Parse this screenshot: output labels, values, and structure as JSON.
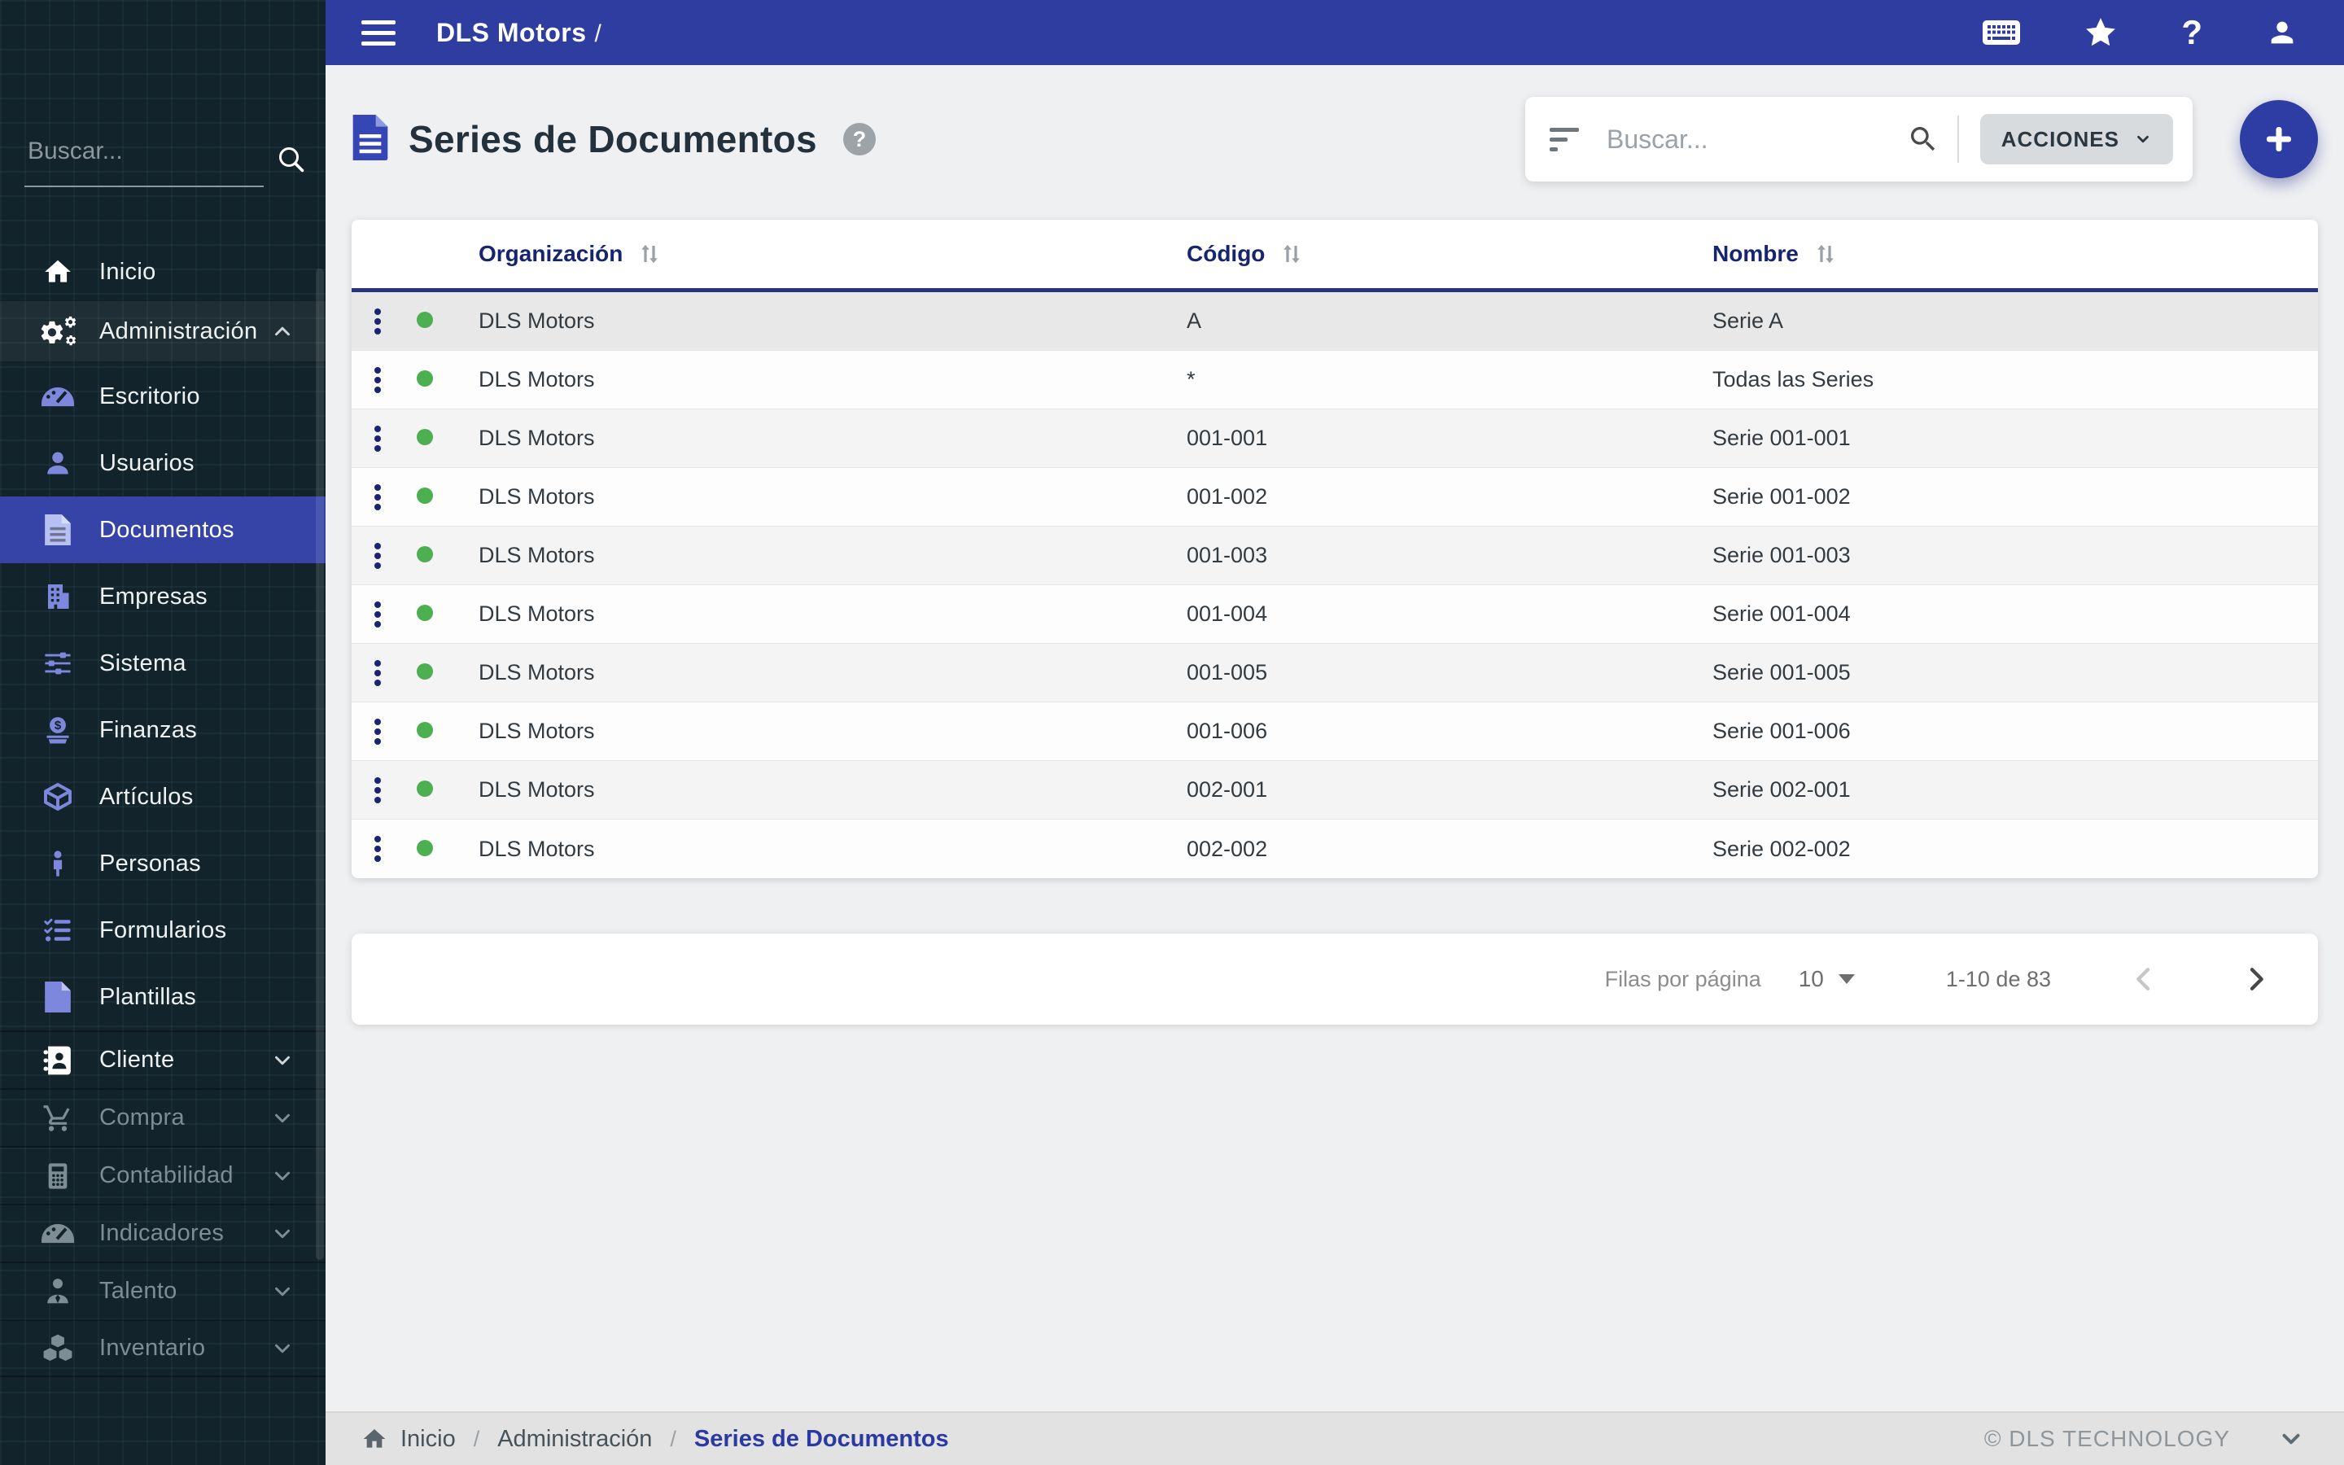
{
  "topbar": {
    "app_title": "DLS Motors",
    "title_separator": "/"
  },
  "icons": {
    "help_glyph": "?"
  },
  "sidebar": {
    "search_placeholder": "Buscar...",
    "items": [
      {
        "label": "Inicio"
      },
      {
        "label": "Administración"
      },
      {
        "label": "Escritorio"
      },
      {
        "label": "Usuarios"
      },
      {
        "label": "Documentos"
      },
      {
        "label": "Empresas"
      },
      {
        "label": "Sistema"
      },
      {
        "label": "Finanzas"
      },
      {
        "label": "Artículos"
      },
      {
        "label": "Personas"
      },
      {
        "label": "Formularios"
      },
      {
        "label": "Plantillas"
      },
      {
        "label": "Cliente"
      },
      {
        "label": "Compra"
      },
      {
        "label": "Contabilidad"
      },
      {
        "label": "Indicadores"
      },
      {
        "label": "Talento"
      },
      {
        "label": "Inventario"
      }
    ]
  },
  "page": {
    "title": "Series de Documentos"
  },
  "toolbar": {
    "search_placeholder": "Buscar...",
    "actions_label": "ACCIONES"
  },
  "table": {
    "columns": [
      "Organización",
      "Código",
      "Nombre"
    ],
    "rows": [
      {
        "org": "DLS Motors",
        "code": "A",
        "name": "Serie A"
      },
      {
        "org": "DLS Motors",
        "code": "*",
        "name": "Todas las Series"
      },
      {
        "org": "DLS Motors",
        "code": "001-001",
        "name": "Serie 001-001"
      },
      {
        "org": "DLS Motors",
        "code": "001-002",
        "name": "Serie 001-002"
      },
      {
        "org": "DLS Motors",
        "code": "001-003",
        "name": "Serie 001-003"
      },
      {
        "org": "DLS Motors",
        "code": "001-004",
        "name": "Serie 001-004"
      },
      {
        "org": "DLS Motors",
        "code": "001-005",
        "name": "Serie 001-005"
      },
      {
        "org": "DLS Motors",
        "code": "001-006",
        "name": "Serie 001-006"
      },
      {
        "org": "DLS Motors",
        "code": "002-001",
        "name": "Serie 002-001"
      },
      {
        "org": "DLS Motors",
        "code": "002-002",
        "name": "Serie 002-002"
      }
    ]
  },
  "pagination": {
    "rows_per_page_label": "Filas por página",
    "rows_per_page_value": "10",
    "range_label": "1-10 de 83"
  },
  "footer": {
    "breadcrumb": [
      "Inicio",
      "Administración",
      "Series de Documentos"
    ],
    "separator": "/",
    "copyright": "© DLS TECHNOLOGY"
  },
  "colors": {
    "topbar": "#2f3da0",
    "sidebar_bg": "#13232b",
    "selected_item": "#3644a8",
    "subitem_icon": "#7d88dd",
    "table_header_text": "#17256f",
    "status_ok": "#4caf50",
    "fab": "#2e3da3"
  }
}
